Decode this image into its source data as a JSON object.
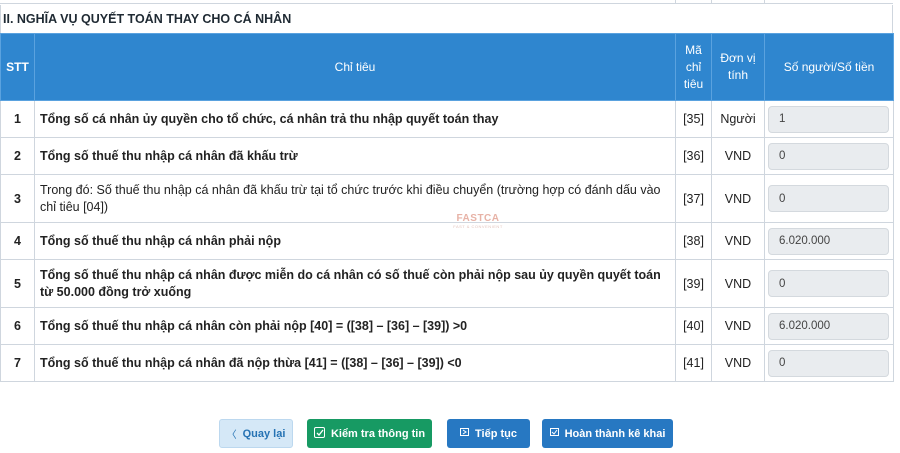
{
  "section": {
    "title": "II. NGHĨA VỤ QUYẾT TOÁN THAY CHO CÁ NHÂN"
  },
  "table": {
    "headers": {
      "stt": "STT",
      "chi_tieu": "Chỉ tiêu",
      "ma_chi_tieu": "Mã chỉ tiêu",
      "don_vi_tinh": "Đơn vị tính",
      "so_nguoi_so_tien": "Số người/Số tiền"
    },
    "rows": [
      {
        "stt": "1",
        "label": "Tổng số cá nhân ủy quyền cho tổ chức, cá nhân trả thu nhập quyết toán thay",
        "code": "[35]",
        "unit": "Người",
        "value": "1"
      },
      {
        "stt": "2",
        "label": "Tổng số thuế thu nhập cá nhân đã khấu trừ",
        "code": "[36]",
        "unit": "VND",
        "value": "0"
      },
      {
        "stt": "3",
        "label": "Trong đó: Số thuế thu nhập cá nhân đã khấu trừ tại tổ chức trước khi điều chuyển (trường hợp có đánh dấu vào chỉ tiêu [04])",
        "code": "[37]",
        "unit": "VND",
        "value": "0"
      },
      {
        "stt": "4",
        "label": "Tổng số thuế thu nhập cá nhân phải nộp",
        "code": "[38]",
        "unit": "VND",
        "value": "6.020.000"
      },
      {
        "stt": "5",
        "label": "Tổng số thuế thu nhập cá nhân được miễn do cá nhân có số thuế còn phải nộp sau ủy quyền quyết toán từ 50.000 đồng trở xuống",
        "code": "[39]",
        "unit": "VND",
        "value": "0"
      },
      {
        "stt": "6",
        "label": "Tổng số thuế thu nhập cá nhân còn phải nộp [40] = ([38] – [36] – [39]) >0",
        "code": "[40]",
        "unit": "VND",
        "value": "6.020.000"
      },
      {
        "stt": "7",
        "label": "Tổng số thuế thu nhập cá nhân đã nộp thừa [41] = ([38] – [36] – [39]) <0",
        "code": "[41]",
        "unit": "VND",
        "value": "0"
      }
    ]
  },
  "watermark": {
    "brand": "FASTCA",
    "tagline": "FAST & CONVENIENT"
  },
  "actions": {
    "back_label": "Quay lại",
    "check_label": "Kiểm tra thông tin",
    "next_label": "Tiếp tục",
    "finish_label": "Hoàn thành kê khai",
    "icons": {
      "back": "chevron-left-icon",
      "check": "edit-check-icon",
      "next": "next-icon",
      "finish": "finish-icon"
    }
  },
  "colors": {
    "header_bg": "#2f86cf",
    "check_button": "#179a63",
    "primary_button": "#2778c2",
    "back_button_bg": "#d5e8f7",
    "input_bg": "#e9ecef"
  }
}
